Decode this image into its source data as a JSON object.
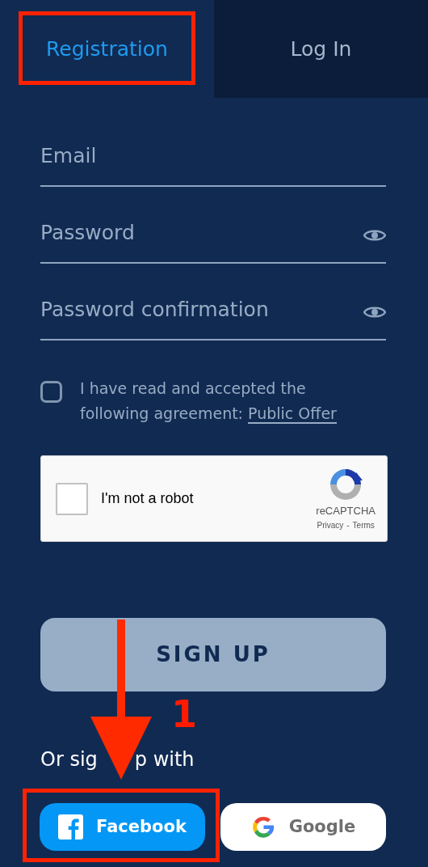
{
  "tabs": [
    {
      "label": "Registration",
      "selected": true
    },
    {
      "label": "Log In",
      "selected": false
    }
  ],
  "fields": [
    {
      "placeholder": "Email",
      "reveal": false
    },
    {
      "placeholder": "Password",
      "reveal": true
    },
    {
      "placeholder": "Password confirmation",
      "reveal": true
    }
  ],
  "agreement": {
    "checked": false,
    "text": "I have read and accepted the following agreement:",
    "link": "Public Offer"
  },
  "captcha": {
    "checked": false,
    "label": "I'm not a robot",
    "brand": "reCAPTCHA",
    "privacy": "Privacy",
    "separator": "-",
    "terms": "Terms"
  },
  "submit": {
    "label": "SIGN UP"
  },
  "social": {
    "heading_parts": [
      "Or sig",
      "p with"
    ],
    "buttons": [
      {
        "kind": "facebook",
        "label": "Facebook"
      },
      {
        "kind": "google",
        "label": "Google"
      }
    ]
  },
  "annotation": {
    "step": "1"
  }
}
